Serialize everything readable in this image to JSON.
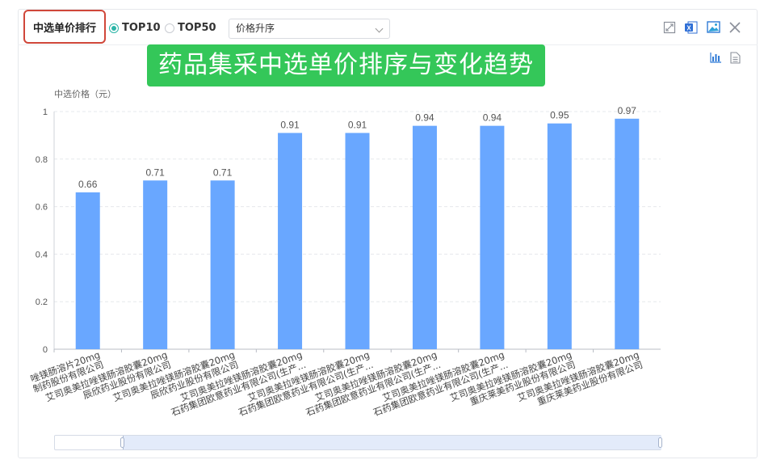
{
  "header": {
    "title": "中选单价排行",
    "radios": [
      {
        "label": "TOP10",
        "selected": true
      },
      {
        "label": "TOP50",
        "selected": false
      }
    ],
    "sort_select": {
      "value": "价格升序"
    }
  },
  "toolbar_icons": [
    "expand-icon",
    "excel-export-icon",
    "image-export-icon",
    "close-icon",
    "bar-chart-icon",
    "document-icon"
  ],
  "banner": {
    "text": "药品集采中选单价排序与变化趋势",
    "color": "#34c759"
  },
  "colors": {
    "bar": "#69a7ff",
    "accent": "#2bb5a7",
    "highlight_border": "#d0473a"
  },
  "chart_data": {
    "type": "bar",
    "ylabel": "中选价格（元）",
    "ylim": [
      0,
      1
    ],
    "yticks": [
      "0",
      "0.2",
      "0.4",
      "0.6",
      "0.8",
      "1"
    ],
    "grid": true,
    "categories": [
      [
        "唑镁肠溶片20mg",
        "制药股份有限公司"
      ],
      [
        "艾司奥美拉唑镁肠溶胶囊20mg",
        "辰欣药业股份有限公司"
      ],
      [
        "艾司奥美拉唑镁肠溶胶囊20mg",
        "辰欣药业股份有限公司"
      ],
      [
        "艾司奥美拉唑镁肠溶胶囊20mg",
        "石药集团欧意药业有限公司(生产..."
      ],
      [
        "艾司奥美拉唑镁肠溶胶囊20mg",
        "石药集团欧意药业有限公司(生产..."
      ],
      [
        "艾司奥美拉唑镁肠溶胶囊20mg",
        "石药集团欧意药业有限公司(生产..."
      ],
      [
        "艾司奥美拉唑镁肠溶胶囊20mg",
        "石药集团欧意药业有限公司(生产..."
      ],
      [
        "艾司奥美拉唑镁肠溶胶囊20mg",
        "重庆莱美药业股份有限公司"
      ],
      [
        "艾司奥美拉唑镁肠溶胶囊20mg",
        "重庆莱美药业股份有限公司"
      ]
    ],
    "values": [
      0.66,
      0.71,
      0.71,
      0.91,
      0.91,
      0.94,
      0.94,
      0.95,
      0.97
    ]
  },
  "data_zoom": {
    "start_fraction": 0.11,
    "end_fraction": 1.0
  }
}
